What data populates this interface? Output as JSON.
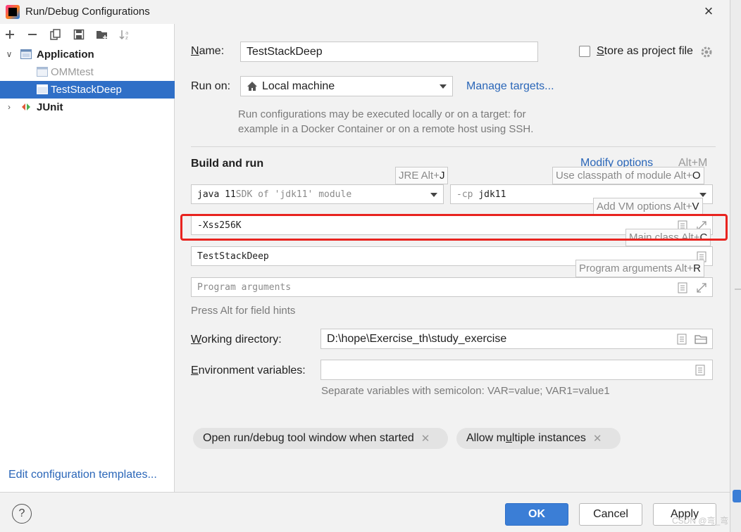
{
  "window": {
    "title": "Run/Debug Configurations"
  },
  "sidebar": {
    "tree": [
      {
        "label": "Application",
        "bold": true,
        "level": 0,
        "expanded": true,
        "selected": false
      },
      {
        "label": "OMMtest",
        "bold": false,
        "level": 1,
        "dimmed": true,
        "selected": false
      },
      {
        "label": "TestStackDeep",
        "bold": false,
        "level": 1,
        "selected": true
      },
      {
        "label": "JUnit",
        "bold": true,
        "level": 0,
        "expanded": false,
        "selected": false
      }
    ],
    "edit_templates": "Edit configuration templates..."
  },
  "form": {
    "name_label": "Name:",
    "name_underline": "N",
    "name_rest": "ame:",
    "name_value": "TestStackDeep",
    "store_label_prefix": "S",
    "store_label_rest": "tore as project file",
    "store_checked": false,
    "run_on_label": "Run on:",
    "run_on_value": "Local machine",
    "manage_targets": "Manage targets...",
    "run_on_note_line1": "Run configurations may be executed locally or on a target: for",
    "run_on_note_line2": "example in a Docker Container or on a remote host using SSH.",
    "build_and_run": "Build and run",
    "modify_options": "Modify options",
    "modify_shortcut": "Alt+M",
    "jre_hint": "JRE Alt+",
    "jre_hint_key": "J",
    "classpath_hint": "Use classpath of module Alt+",
    "classpath_hint_key": "O",
    "jre_value_main": "java 11",
    "jre_value_sub": " SDK of 'jdk11' module",
    "cp_flag": "-cp",
    "cp_value": "jdk11",
    "vm_hint": "Add VM options Alt+",
    "vm_hint_key": "V",
    "vm_options": "-Xss256K",
    "main_class_hint": "Main class Alt+",
    "main_class_hint_key": "C",
    "main_class": "TestStackDeep",
    "program_args_hint": "Program arguments Alt+",
    "program_args_hint_key": "R",
    "program_args_placeholder": "Program arguments",
    "press_alt": "Press Alt for field hints",
    "working_dir_label_u": "W",
    "working_dir_label_rest": "orking directory:",
    "working_dir": "D:\\hope\\Exercise_th\\study_exercise",
    "env_label_u": "E",
    "env_label_rest": "nvironment variables:",
    "env_value": "",
    "env_note": "Separate variables with semicolon: VAR=value; VAR1=value1"
  },
  "chips": [
    {
      "label": "Open run/debug tool window when started"
    },
    {
      "label_before": "Allow m",
      "label_u": "u",
      "label_after": "ltiple instances"
    }
  ],
  "buttons": {
    "help": "?",
    "ok": "OK",
    "cancel": "Cancel",
    "apply": "Apply"
  },
  "watermark": "CSDN @弯_弯",
  "colors": {
    "accent": "#2f6fc7",
    "link": "#2a66b8",
    "highlight_box": "#e8231f"
  }
}
